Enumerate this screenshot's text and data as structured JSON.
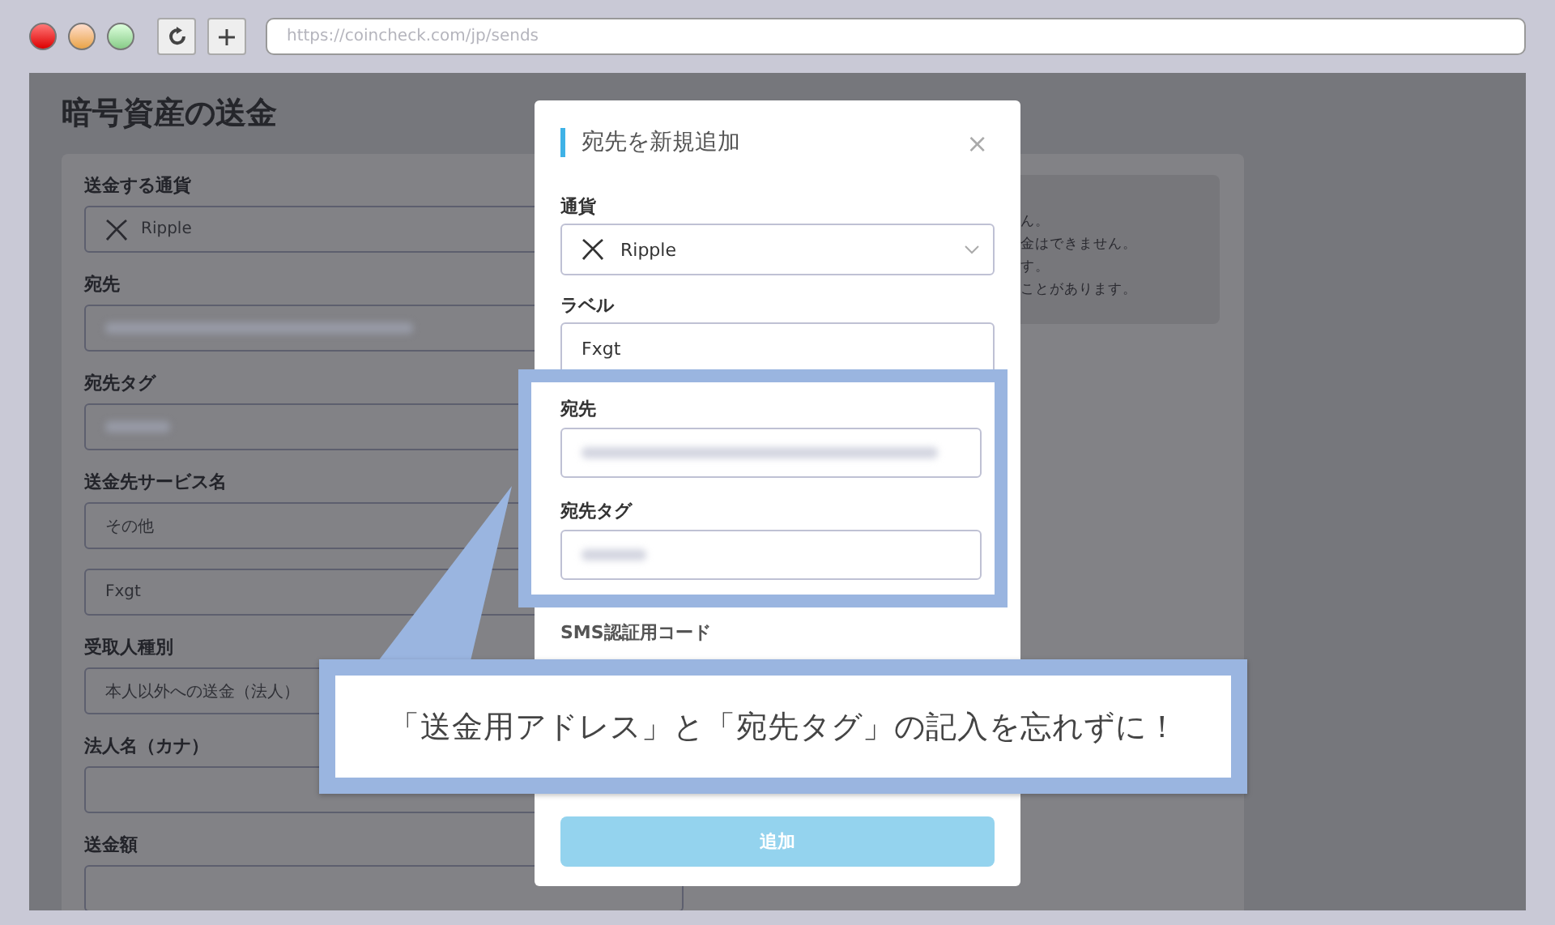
{
  "browser": {
    "url": "https://coincheck.com/jp/sends"
  },
  "page": {
    "title": "暗号資産の送金",
    "fields": [
      {
        "label": "送金する通貨",
        "kind": "currency",
        "value": "Ripple"
      },
      {
        "label": "宛先",
        "kind": "blurred"
      },
      {
        "label": "宛先タグ",
        "kind": "blurred"
      },
      {
        "label": "送金先サービス名",
        "kind": "text",
        "value": "その他"
      },
      {
        "kind": "text",
        "value": "Fxgt"
      },
      {
        "label": "受取人種別",
        "kind": "text",
        "value": "本人以外への送金（法人）"
      },
      {
        "label": "法人名（カナ）",
        "kind": "empty"
      },
      {
        "label": "送金額",
        "kind": "empty"
      }
    ],
    "notice_lines": [
      "ん。",
      "金はできません。",
      "す。",
      "ことがあります。"
    ]
  },
  "modal": {
    "title": "宛先を新規追加",
    "close": "×",
    "fields": [
      {
        "label": "通貨",
        "kind": "select",
        "value": "Ripple"
      },
      {
        "label": "ラベル",
        "kind": "text",
        "value": "Fxgt"
      }
    ],
    "highlighted_fields": [
      {
        "label": "宛先",
        "kind": "blurred"
      },
      {
        "label": "宛先タグ",
        "kind": "blurred"
      }
    ],
    "sms_label": "SMS認証用コード",
    "submit": {
      "label": "追加",
      "disabled": true
    }
  },
  "callout": {
    "text": "「送金用アドレス」と「宛先タグ」の記入を忘れずに！"
  }
}
